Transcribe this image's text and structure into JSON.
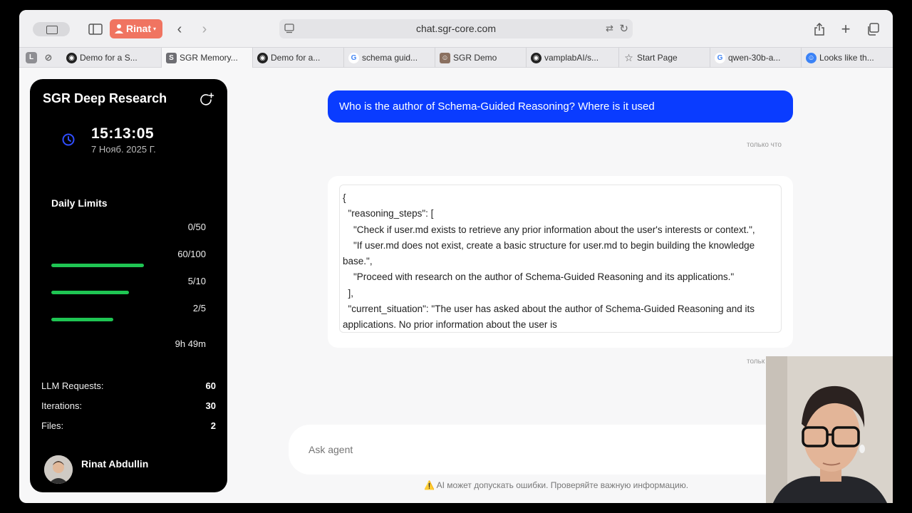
{
  "toolbar": {
    "profile_label": "Rinat",
    "url": "chat.sgr-core.com"
  },
  "tabs": [
    {
      "label": "Demo for a S..."
    },
    {
      "label": "SGR Memory..."
    },
    {
      "label": "Demo for a..."
    },
    {
      "label": "schema guid..."
    },
    {
      "label": "SGR Demo"
    },
    {
      "label": "vamplabAI/s..."
    },
    {
      "label": "Start Page"
    },
    {
      "label": "qwen-30b-a..."
    },
    {
      "label": "Looks like th..."
    }
  ],
  "pinned_tab_letter": "L",
  "sidebar": {
    "title": "SGR Deep Research",
    "time": "15:13:05",
    "date": "7 Нояб. 2025 Г.",
    "limits_title": "Daily Limits",
    "limits": [
      {
        "value": "0/50",
        "fill": 0.0
      },
      {
        "value": "60/100",
        "fill": 0.6
      },
      {
        "value": "5/10",
        "fill": 0.5
      },
      {
        "value": "2/5",
        "fill": 0.4
      }
    ],
    "reset_time": "9h 49m",
    "stats": [
      {
        "label": "LLM Requests:",
        "value": "60"
      },
      {
        "label": "Iterations:",
        "value": "30"
      },
      {
        "label": "Files:",
        "value": "2"
      }
    ],
    "user_name": "Rinat Abdullin"
  },
  "chat": {
    "user_message": "Who is the author of Schema-Guided Reasoning? Where is it used",
    "user_timestamp": "только что",
    "bot_code": "{\n  \"reasoning_steps\": [\n    \"Check if user.md exists to retrieve any prior information about the user's interests or context.\",\n    \"If user.md does not exist, create a basic structure for user.md to begin building the knowledge base.\",\n    \"Proceed with research on the author of Schema-Guided Reasoning and its applications.\"\n  ],\n  \"current_situation\": \"The user has asked about the author of Schema-Guided Reasoning and its applications. No prior information about the user is",
    "bot_timestamp": "тольк",
    "input_placeholder": "Ask agent",
    "disclaimer": "⚠️ AI может допускать ошибки. Проверяйте важную информацию."
  },
  "colors": {
    "accent_blue": "#0a3cff",
    "progress_green": "#1fc553",
    "profile_red": "#f07461"
  }
}
